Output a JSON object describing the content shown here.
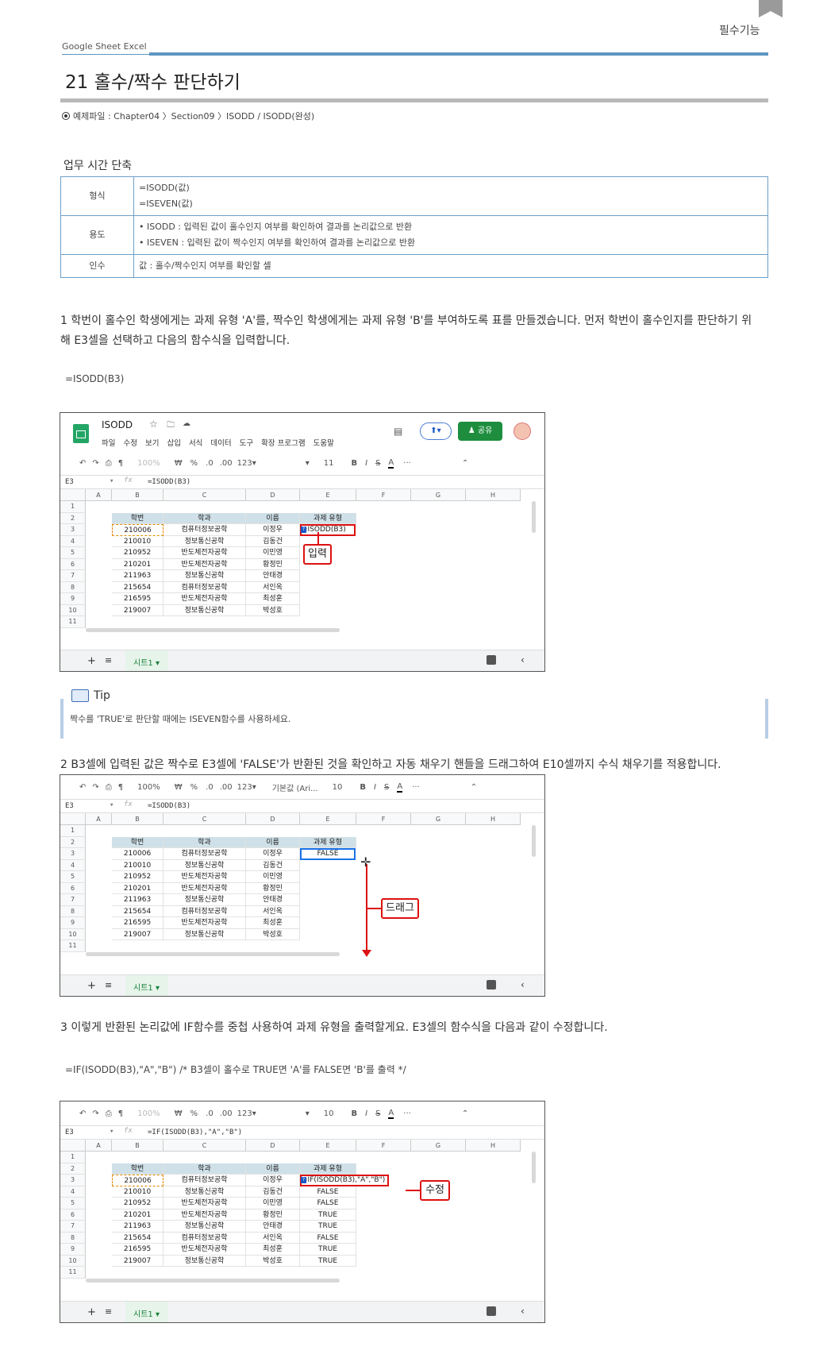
{
  "header": {
    "section_label": "필수기능",
    "brand": "Google Sheet  Excel",
    "title": "21 홀수/짝수 판단하기",
    "example_file": "예제파일 : Chapter04 〉Section09 〉ISODD / ISODD(완성)"
  },
  "section": {
    "label": "업무 시간 단축"
  },
  "info_table": {
    "rows": [
      {
        "head": "형식",
        "lines": [
          "=ISODD(값)",
          "=ISEVEN(값)"
        ]
      },
      {
        "head": "용도",
        "lines": [
          "• ISODD : 입력된 값이 홀수인지 여부를 확인하여 결과를 논리값으로 반환",
          "• ISEVEN : 입력된 값이 짝수인지 여부를 확인하여 결과를 논리값으로 반환"
        ]
      },
      {
        "head": "인수",
        "lines": [
          "값 : 홀수/짝수인지 여부를 확인할 셀"
        ]
      }
    ]
  },
  "step1": {
    "text_line1": "1 학번이 홀수인 학생에게는 과제 유형 'A'를, 짝수인 학생에게는 과제 유형 'B'를 부여하도록 표를 만들겠습니다. 먼저 학번이 홀수인지를 판단하기 위",
    "text_line2": "해 E3셀을 선택하고 다음의 함수식을 입력합니다.",
    "formula": "=ISODD(B3)"
  },
  "tip": {
    "label": "Tip",
    "text": "짝수를 'TRUE'로 판단할 때에는 ISEVEN함수를 사용하세요."
  },
  "step2": {
    "text": "2 B3셀에 입력된 값은 짝수로 E3셀에 'FALSE'가 반환된 것을 확인하고 자동 채우기 핸들을 드래그하여 E10셀까지 수식 채우기를 적용합니다."
  },
  "step3": {
    "text": "3 이렇게 반환된 논리값에 IF함수를 중첩 사용하여 과제 유형을 출력할게요. E3셀의 함수식을 다음과 같이 수정합니다.",
    "formula": "=IF(ISODD(B3),\"A\",\"B\") /* B3셀이 홀수로 TRUE면 'A'를 FALSE면 'B'를 출력 */"
  },
  "sheets": {
    "app_title": "ISODD",
    "menu": [
      "파일",
      "수정",
      "보기",
      "삽입",
      "서식",
      "데이터",
      "도구",
      "확장 프로그램",
      "도움말"
    ],
    "share_label": "공유",
    "zoom": "100%",
    "font_size_1": "11",
    "font_size_2": "10",
    "font_name": "기본값 (Ari...",
    "num_fmt": "123▾",
    "name_box": "E3",
    "col_headers": [
      "A",
      "B",
      "C",
      "D",
      "E",
      "F",
      "G",
      "H"
    ],
    "row_numbers": [
      "1",
      "2",
      "3",
      "4",
      "5",
      "6",
      "7",
      "8",
      "9",
      "10",
      "11"
    ],
    "table_headers": [
      "학번",
      "학과",
      "이름",
      "과제 유형"
    ],
    "students": [
      [
        "210006",
        "컴퓨터정보공학",
        "이정우"
      ],
      [
        "210010",
        "정보통신공학",
        "김동건"
      ],
      [
        "210952",
        "반도체전자공학",
        "이민영"
      ],
      [
        "210201",
        "반도체전자공학",
        "황정민"
      ],
      [
        "211963",
        "정보통신공학",
        "안태경"
      ],
      [
        "215654",
        "컴퓨터정보공학",
        "서인옥"
      ],
      [
        "216595",
        "반도체전자공학",
        "최성훈"
      ],
      [
        "219007",
        "정보통신공학",
        "박성호"
      ]
    ],
    "shot1": {
      "formula_bar": "=ISODD(B3)",
      "e3": "=ISODD(B3)",
      "callout": "입력"
    },
    "shot2": {
      "formula_bar": "=ISODD(B3)",
      "e3": "FALSE",
      "callout": "드래그"
    },
    "shot3": {
      "formula_bar": "=IF(ISODD(B3),\"A\",\"B\")",
      "e3": "=IF(ISODD(B3),\"A\",\"B\")",
      "results": [
        "FALSE",
        "FALSE",
        "TRUE",
        "TRUE",
        "FALSE",
        "TRUE",
        "TRUE"
      ],
      "callout": "수정"
    },
    "sheet_tab": "시트1 ▾"
  }
}
